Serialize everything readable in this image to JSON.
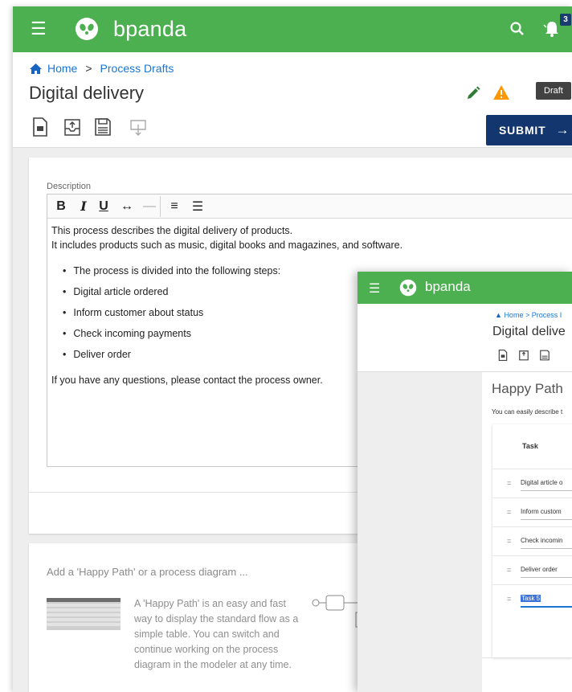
{
  "app": {
    "brand": "bpanda",
    "notifications": "3"
  },
  "breadcrumb": {
    "home": "Home",
    "separator": ">",
    "current": "Process Drafts"
  },
  "page": {
    "title": "Digital delivery",
    "status": "Draft",
    "submit_label": "SUBMIT",
    "submit_arrow": "→"
  },
  "toolbar_icons": [
    "document-icon",
    "upload-icon",
    "save-icon",
    "download-icon"
  ],
  "description": {
    "label": "Description",
    "editor_tools": {
      "bold": "B",
      "italic": "I",
      "underline": "U",
      "link": "↔",
      "rule": "—",
      "align": "≡",
      "list": "☰"
    },
    "intro_1": "This process describes the digital delivery of products.",
    "intro_2": "It includes products such as music, digital books and magazines, and software.",
    "bullets": [
      "The process is divided into the following steps:",
      "Digital article ordered",
      "Inform customer about status",
      "Check incoming payments",
      "Deliver order"
    ],
    "closing": "If you have any questions, please contact the process owner."
  },
  "add_section": {
    "title": "Add a 'Happy Path' or a process diagram ...",
    "happy_path_text": "A 'Happy Path' is an easy and fast way to display the standard flow as a simple table. You can switch and continue working on the process diagram in the modeler at any time."
  },
  "overlay": {
    "brand": "bpanda",
    "breadcrumb": "Home  >  Process I",
    "title": "Digital delive",
    "happy_path_title": "Happy Path",
    "happy_path_desc": "You can easily describe t",
    "table_header": "Task",
    "rows": [
      "Digital article o",
      "Inform custom",
      "Check incomin",
      "Deliver order",
      "Task 5"
    ],
    "handle": "="
  },
  "colors": {
    "app_bar": "#4caf50",
    "submit": "#12366d",
    "link": "#1976d2",
    "warning": "#ff9800"
  }
}
